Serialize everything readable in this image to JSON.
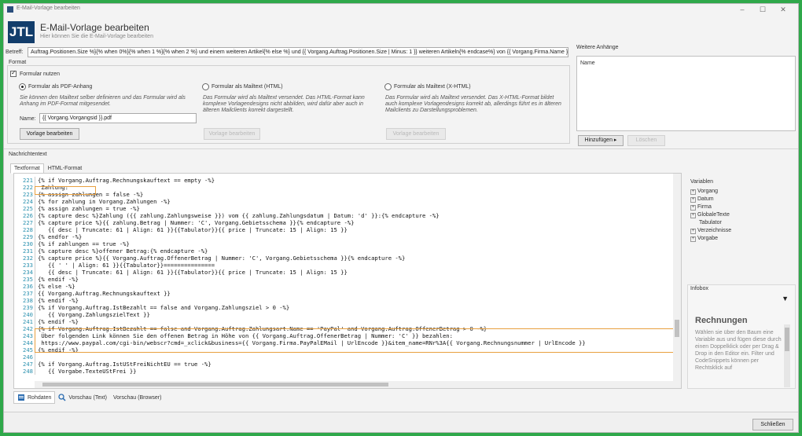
{
  "window": {
    "title": "E-Mail-Vorlage bearbeiten",
    "heading": "E-Mail-Vorlage bearbeiten",
    "subheading": "Hier können Sie die E-Mail-Vorlage bearbeiten",
    "logo": "JTL"
  },
  "subject": {
    "label": "Betreff:",
    "value": "Auftrag.Positionen.Size %}{% when 0%}{% when 1 %}{% when 2 %} und einem weiteren Artikel{% else %} und {{ Vorgang.Auftrag.Positionen.Size | Minus: 1 }} weiteren Artikeln{% endcase%} von {{ Vorgang.Firma.Name }}"
  },
  "format": {
    "group_label": "Format",
    "use_form_label": "Formular nutzen",
    "options": [
      {
        "label": "Formular als PDF-Anhang",
        "desc": "Sie können den Mailtext selber definieren und das Formular wird als Anhang im PDF-Format mitgesendet.",
        "selected": true
      },
      {
        "label": "Formular als Mailtext (HTML)",
        "desc": "Das Formular wird als Mailtext versendet. Das HTML-Format kann komplexe Vorlagendesigns nicht abbilden, wird dafür aber auch in älteren Mailclients korrekt dargestellt.",
        "selected": false
      },
      {
        "label": "Formular als Mailtext (X-HTML)",
        "desc": "Das Formular wird als Mailtext versendet. Das X-HTML-Format bildet auch komplexe Vorlagendesigns korrekt ab, allerdings führt es in älteren Mailclients zu Darstellungsproblemen.",
        "selected": false
      }
    ],
    "name_label": "Name:",
    "name_value": "{{ Vorgang.Vorgangsid }}.pdf",
    "edit_button": "Vorlage bearbeiten",
    "edit_button_2": "Vorlage bearbeiten",
    "edit_button_3": "Vorlage bearbeiten"
  },
  "attachments": {
    "group_label": "Weitere Anhänge",
    "col_name": "Name",
    "add_button": "Hinzufügen",
    "add_arrow": "▸",
    "delete_button": "Löschen"
  },
  "message": {
    "label": "Nachrichtentext",
    "tabs": [
      "Textformat",
      "HTML-Format"
    ]
  },
  "code_lines": [
    {
      "n": "221",
      "t": "{% if Vorgang.Auftrag.Rechnungskauftext == empty -%}"
    },
    {
      "n": "222",
      "t": " Zahlung:"
    },
    {
      "n": "223",
      "t": "{% assign zahlungen = false -%}"
    },
    {
      "n": "224",
      "t": "{% for zahlung in Vorgang.Zahlungen -%}"
    },
    {
      "n": "225",
      "t": "{% assign zahlungen = true -%}"
    },
    {
      "n": "226",
      "t": "{% capture desc %}Zahlung ({{ zahlung.Zahlungsweise }}) vom {{ zahlung.Zahlungsdatum | Datum: 'd' }}:{% endcapture -%}"
    },
    {
      "n": "227",
      "t": "{% capture price %}{{ zahlung.Betrag | Nummer: 'C', Vorgang.Gebietsschema }}{% endcapture -%}"
    },
    {
      "n": "228",
      "t": "   {{ desc | Truncate: 61 | Align: 61 }}{{Tabulator}}{{ price | Truncate: 15 | Align: 15 }}"
    },
    {
      "n": "229",
      "t": "{% endfor -%}"
    },
    {
      "n": "230",
      "t": "{% if zahlungen == true -%}"
    },
    {
      "n": "231",
      "t": "{% capture desc %}offener Betrag:{% endcapture -%}"
    },
    {
      "n": "232",
      "t": "{% capture price %}{{ Vorgang.Auftrag.OffenerBetrag | Nummer: 'C', Vorgang.Gebietsschema }}{% endcapture -%}"
    },
    {
      "n": "233",
      "t": "   {{ ' ' | Align: 61 }}{{Tabulator}}==============="
    },
    {
      "n": "234",
      "t": "   {{ desc | Truncate: 61 | Align: 61 }}{{Tabulator}}{{ price | Truncate: 15 | Align: 15 }}"
    },
    {
      "n": "235",
      "t": "{% endif -%}"
    },
    {
      "n": "236",
      "t": "{% else -%}"
    },
    {
      "n": "237",
      "t": "{{ Vorgang.Auftrag.Rechnungskauftext }}"
    },
    {
      "n": "238",
      "t": "{% endif -%}"
    },
    {
      "n": "239",
      "t": "{% if Vorgang.Auftrag.IstBezahlt == false and Vorgang.Zahlungsziel > 0 -%}"
    },
    {
      "n": "240",
      "t": "   {{ Vorgang.ZahlungszielText }}"
    },
    {
      "n": "241",
      "t": "{% endif -%}"
    },
    {
      "n": "242",
      "t": "{% if Vorgang.Auftrag.IstBezahlt == false and Vorgang.Auftrag.Zahlungsart.Name == 'PayPal' and Vorgang.Auftrag.OffenerBetrag > 0 -%}"
    },
    {
      "n": "243",
      "t": " Über folgenden Link können Sie den offenen Betrag in Höhe von {{ Vorgang.Auftrag.OffenerBetrag | Nummer: 'C' }} bezahlen:"
    },
    {
      "n": "244",
      "t": " https://www.paypal.com/cgi-bin/webscr?cmd=_xclick&business={{ Vorgang.Firma.PayPalEMail | UrlEncode }}&item_name=RNr%3A{{ Vorgang.Rechnungsnummer | UrlEncode }}"
    },
    {
      "n": "245",
      "t": "{% endif -%}"
    },
    {
      "n": "246",
      "t": ""
    },
    {
      "n": "247",
      "t": "{% if Vorgang.Auftrag.IstUStFreiNichtEU == true -%}"
    },
    {
      "n": "248",
      "t": "   {{ Vorgabe.TexteUStFrei }}"
    }
  ],
  "variables": {
    "label": "Variablen",
    "items": [
      "Vorgang",
      "Datum",
      "Firma",
      "GlobaleTexte",
      "Tabulator",
      "Verzeichnisse",
      "Vorgabe"
    ]
  },
  "infobox": {
    "label": "Infobox",
    "dropdown": "▼",
    "title": "Rechnungen",
    "text": "Wählen sie über den Baum eine Variable aus und fügen diese durch einen Doppelklick oder per Drag & Drop in den Editor ein. Filter und CodeSnippets können per Rechtsklick auf"
  },
  "bottom_tabs": [
    "Rohdaten",
    "Vorschau (Text)",
    "Vorschau (Browser)"
  ],
  "footer": {
    "close_button": "Schließen"
  }
}
